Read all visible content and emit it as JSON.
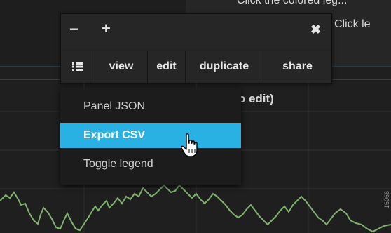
{
  "background": {
    "hint_line_1": "Click the colored leg...",
    "hint_line_2": "Click le",
    "panel_title": "e to edit)",
    "side_label": "16066"
  },
  "panel_menu": {
    "minus_label": "−",
    "plus_label": "+",
    "close_label": "✖",
    "actions": [
      {
        "label": "≣",
        "icon": "list-icon"
      },
      {
        "label": "view"
      },
      {
        "label": "edit"
      },
      {
        "label": "duplicate"
      },
      {
        "label": "share"
      }
    ]
  },
  "dropdown": {
    "items": [
      {
        "label": "Panel JSON"
      },
      {
        "label": "Export CSV",
        "highlighted": true
      },
      {
        "label": "Toggle legend"
      }
    ]
  },
  "colors": {
    "highlight": "#2ab1e4",
    "series_line": "#7eb26d"
  }
}
